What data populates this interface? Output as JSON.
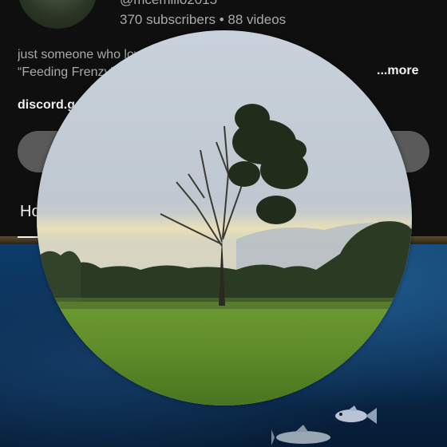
{
  "channel": {
    "handle": "@mcemilio2015",
    "stats": "370 subscribers • 88 videos",
    "description_line1": "just someone who loves the 2006 game",
    "description_line2": "“Feeding Frenzy” and that",
    "more_label": "...more",
    "link_text": "discord.gg",
    "home_tab_label": "Home"
  },
  "overlay": {
    "content": "landscape-video-bubble"
  },
  "colors": {
    "background": "#0f0f0f",
    "secondary_text": "#aaaaaa",
    "primary_text": "#f1f1f1",
    "pill": "#5a5a5a",
    "aquarium_water": "#0a2c52"
  }
}
